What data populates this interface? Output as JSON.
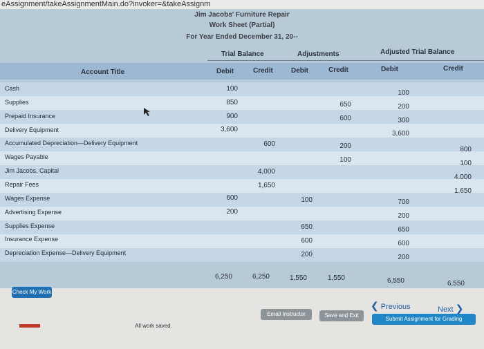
{
  "browser": {
    "url": "eAssignment/takeAssignmentMain.do?invoker=&takeAssignm"
  },
  "worksheet": {
    "company": "Jim Jacobs' Furniture Repair",
    "title": "Work Sheet (Partial)",
    "period": "For Year Ended December 31, 20--"
  },
  "headers": {
    "trial_balance": "Trial Balance",
    "adjustments": "Adjustments",
    "adjusted_trial_balance": "Adjusted Trial Balance",
    "account_title": "Account Title",
    "debit": "Debit",
    "credit": "Credit"
  },
  "rows": [
    {
      "account": "Cash",
      "tb_debit": "100",
      "tb_credit": "",
      "adj_debit": "",
      "adj_credit": "",
      "atb_debit": "100",
      "atb_credit": ""
    },
    {
      "account": "Supplies",
      "tb_debit": "850",
      "tb_credit": "",
      "adj_debit": "",
      "adj_credit": "650",
      "atb_debit": "200",
      "atb_credit": ""
    },
    {
      "account": "Prepaid Insurance",
      "tb_debit": "900",
      "tb_credit": "",
      "adj_debit": "",
      "adj_credit": "600",
      "atb_debit": "300",
      "atb_credit": ""
    },
    {
      "account": "Delivery Equipment",
      "tb_debit": "3,600",
      "tb_credit": "",
      "adj_debit": "",
      "adj_credit": "",
      "atb_debit": "3,600",
      "atb_credit": ""
    },
    {
      "account": "Accumulated Depreciation—Delivery Equipment",
      "tb_debit": "",
      "tb_credit": "600",
      "adj_debit": "",
      "adj_credit": "200",
      "atb_debit": "",
      "atb_credit": "800"
    },
    {
      "account": "Wages Payable",
      "tb_debit": "",
      "tb_credit": "",
      "adj_debit": "",
      "adj_credit": "100",
      "atb_debit": "",
      "atb_credit": "100"
    },
    {
      "account": "Jim Jacobs, Capital",
      "tb_debit": "",
      "tb_credit": "4,000",
      "adj_debit": "",
      "adj_credit": "",
      "atb_debit": "",
      "atb_credit": "4,000"
    },
    {
      "account": "Repair Fees",
      "tb_debit": "",
      "tb_credit": "1,650",
      "adj_debit": "",
      "adj_credit": "",
      "atb_debit": "",
      "atb_credit": "1,650"
    },
    {
      "account": "Wages Expense",
      "tb_debit": "600",
      "tb_credit": "",
      "adj_debit": "100",
      "adj_credit": "",
      "atb_debit": "700",
      "atb_credit": ""
    },
    {
      "account": "Advertising Expense",
      "tb_debit": "200",
      "tb_credit": "",
      "adj_debit": "",
      "adj_credit": "",
      "atb_debit": "200",
      "atb_credit": ""
    },
    {
      "account": "Supplies Expense",
      "tb_debit": "",
      "tb_credit": "",
      "adj_debit": "650",
      "adj_credit": "",
      "atb_debit": "650",
      "atb_credit": ""
    },
    {
      "account": "Insurance Expense",
      "tb_debit": "",
      "tb_credit": "",
      "adj_debit": "600",
      "adj_credit": "",
      "atb_debit": "600",
      "atb_credit": ""
    },
    {
      "account": "Depreciation Expense—Delivery Equipment",
      "tb_debit": "",
      "tb_credit": "",
      "adj_debit": "200",
      "adj_credit": "",
      "atb_debit": "200",
      "atb_credit": ""
    }
  ],
  "totals": {
    "tb_debit": "6,250",
    "tb_credit": "6,250",
    "adj_debit": "1,550",
    "adj_credit": "1,550",
    "atb_debit": "6,550",
    "atb_credit": "6,550"
  },
  "buttons": {
    "check_my_work": "Check My Work",
    "previous": "Previous",
    "next": "Next",
    "email_instructor": "Email Instructor",
    "save_and_exit": "Save and Exit",
    "submit": "Submit Assignment for Grading"
  },
  "status": {
    "saved": "All work saved."
  },
  "colors": {
    "header_row": "#9cb8d2",
    "row_a": "#c5d7e6",
    "row_b": "#d9e5ef",
    "check_btn": "#1f6fb5",
    "submit_btn": "#1f86c8",
    "footer_btn": "#8d9499"
  }
}
